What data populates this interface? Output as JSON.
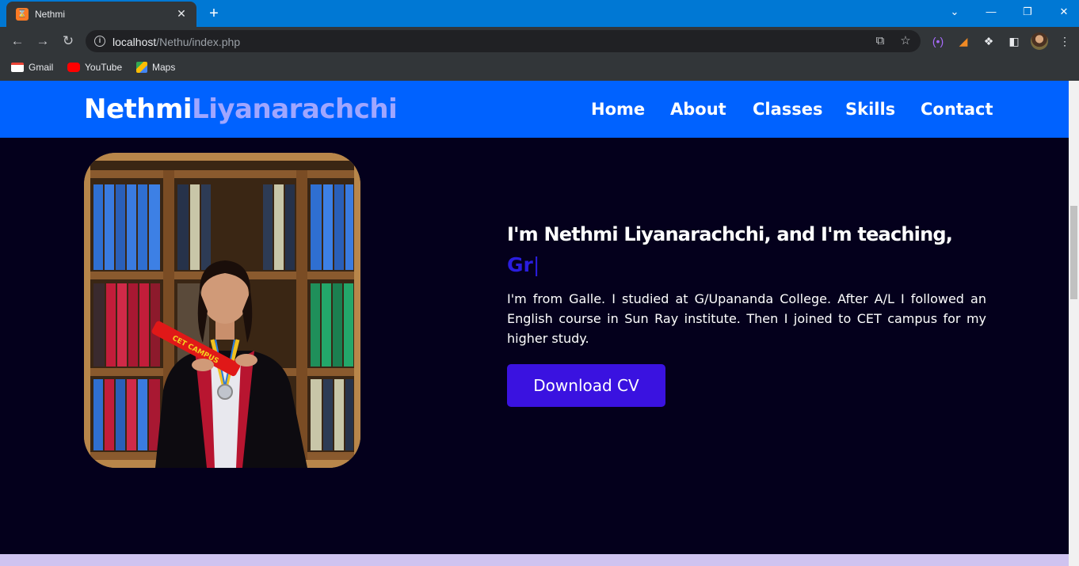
{
  "browser": {
    "tab_title": "Nethmi",
    "tab_favicon": "xampp-icon",
    "url_host": "localhost",
    "url_path": "/Nethu/index.php",
    "bookmarks": [
      {
        "label": "Gmail",
        "icon": "gmail-icon"
      },
      {
        "label": "YouTube",
        "icon": "youtube-icon"
      },
      {
        "label": "Maps",
        "icon": "maps-icon"
      }
    ]
  },
  "navbar": {
    "logo_first": "Nethmi",
    "logo_second": "Liyanarachchi",
    "links": [
      "Home",
      "About",
      "Classes",
      "Skills",
      "Contact"
    ]
  },
  "hero": {
    "title": "I'm Nethmi Liyanarachchi, and I'm teaching,",
    "typed_text": "Gr",
    "typed_cursor": "|",
    "description": "I'm from Galle. I studied at G/Upananda College. After A/L I followed an English course in Sun Ray institute. Then I joined to CET campus for my higher study.",
    "button_label": "Download CV",
    "photo_sash_text": "CET CAMPUS"
  },
  "colors": {
    "navbar": "#0062ff",
    "background": "#04001c",
    "logo_accent": "#a0a6ff",
    "typed_text": "#2a1dde",
    "button": "#3a12e0",
    "next_section": "#cfc3f0"
  }
}
